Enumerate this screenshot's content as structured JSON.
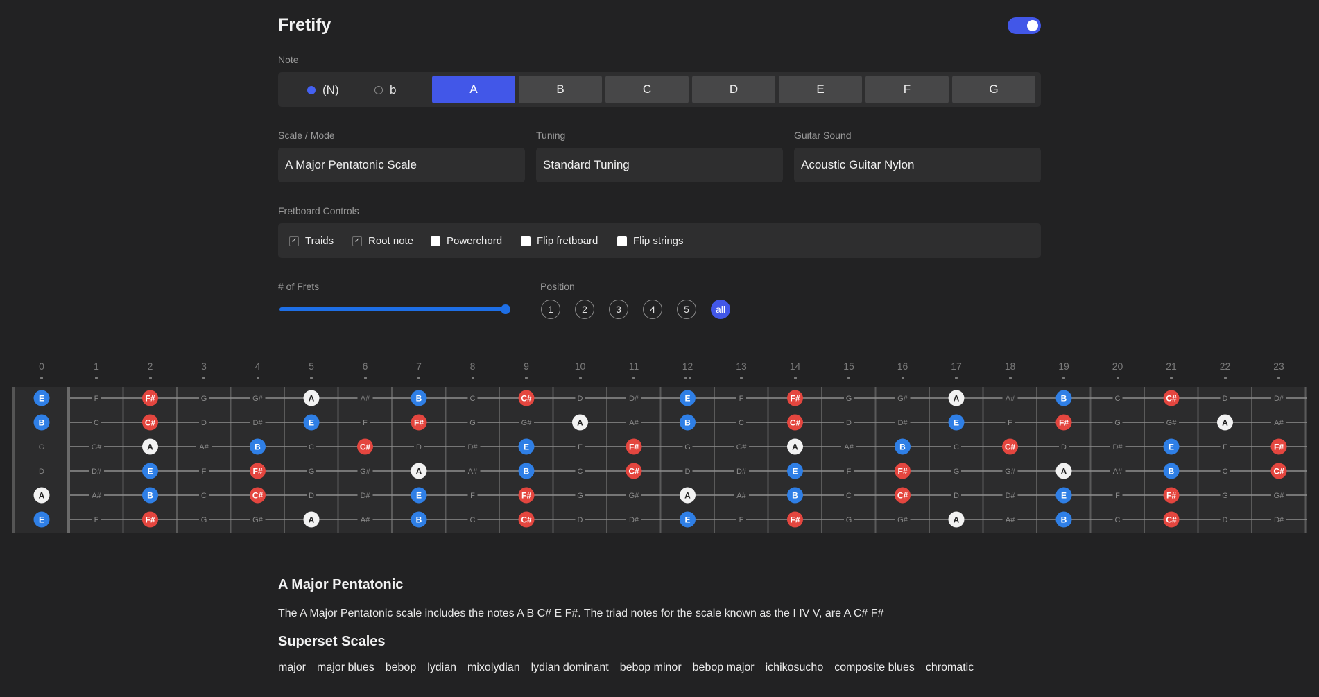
{
  "app": {
    "title": "Fretify",
    "dark_mode": true
  },
  "note_section": {
    "label": "Note",
    "accidentals": [
      {
        "label": "(N)",
        "selected": true
      },
      {
        "label": "b",
        "selected": false
      }
    ],
    "notes": [
      "A",
      "B",
      "C",
      "D",
      "E",
      "F",
      "G"
    ],
    "selected_note": "A"
  },
  "selects": {
    "scale": {
      "label": "Scale / Mode",
      "value": "A Major Pentatonic Scale"
    },
    "tuning": {
      "label": "Tuning",
      "value": "Standard Tuning"
    },
    "sound": {
      "label": "Guitar Sound",
      "value": "Acoustic Guitar Nylon"
    }
  },
  "controls": {
    "label": "Fretboard Controls",
    "options": [
      {
        "label": "Traids",
        "checked": true
      },
      {
        "label": "Root note",
        "checked": true
      },
      {
        "label": "Powerchord",
        "checked": false
      },
      {
        "label": "Flip fretboard",
        "checked": false
      },
      {
        "label": "Flip strings",
        "checked": false
      }
    ]
  },
  "frets": {
    "label": "# of Frets",
    "value_fraction": 1.0
  },
  "position": {
    "label": "Position",
    "options": [
      "1",
      "2",
      "3",
      "4",
      "5",
      "all"
    ],
    "selected": "all"
  },
  "fretboard": {
    "fret_count": 23,
    "fret_numbers": [
      "0",
      "1",
      "2",
      "3",
      "4",
      "5",
      "6",
      "7",
      "8",
      "9",
      "10",
      "11",
      "12",
      "13",
      "14",
      "15",
      "16",
      "17",
      "18",
      "19",
      "20",
      "21",
      "22",
      "23"
    ],
    "single_dot_frets": [
      3,
      5,
      7,
      9,
      15,
      17,
      19,
      21
    ],
    "double_dot_frets": [
      12
    ],
    "string_open_notes": [
      "E",
      "B",
      "G",
      "D",
      "A",
      "E"
    ],
    "chromatic": [
      "A",
      "A#",
      "B",
      "C",
      "C#",
      "D",
      "D#",
      "E",
      "F",
      "F#",
      "G",
      "G#"
    ],
    "scale_notes": [
      "A",
      "B",
      "C#",
      "E",
      "F#"
    ],
    "root": "A",
    "triad_notes": [
      "C#",
      "F#"
    ],
    "colors": {
      "root": "#f2f2f2",
      "triad": "#e4463f",
      "scale": "#2f7fe6",
      "muted_text": "#8a8a8a",
      "string": "#8e8e8e",
      "fret": "#5a5a5a"
    }
  },
  "description": {
    "title": "A Major Pentatonic",
    "text": "The A Major Pentatonic scale includes the notes A B C# E F#. The triad notes for the scale known as the I IV V, are A C# F#"
  },
  "superset": {
    "title": "Superset Scales",
    "items": [
      "major",
      "major blues",
      "bebop",
      "lydian",
      "mixolydian",
      "lydian dominant",
      "bebop minor",
      "bebop major",
      "ichikosucho",
      "composite blues",
      "chromatic"
    ]
  }
}
